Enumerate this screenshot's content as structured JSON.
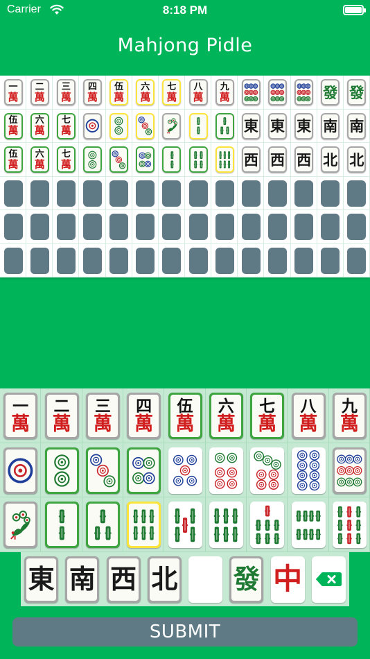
{
  "status_bar": {
    "carrier": "Carrier",
    "time": "8:18 PM"
  },
  "title": "Mahjong Pidle",
  "board": {
    "rows": [
      [
        {
          "suit": "man",
          "num": 1,
          "top": "一",
          "state": "gray"
        },
        {
          "suit": "man",
          "num": 2,
          "top": "二",
          "state": "gray"
        },
        {
          "suit": "man",
          "num": 3,
          "top": "三",
          "state": "gray"
        },
        {
          "suit": "man",
          "num": 4,
          "top": "四",
          "state": "gray"
        },
        {
          "suit": "man",
          "num": 5,
          "top": "伍",
          "state": "yellow"
        },
        {
          "suit": "man",
          "num": 6,
          "top": "六",
          "state": "yellow"
        },
        {
          "suit": "man",
          "num": 7,
          "top": "七",
          "state": "yellow"
        },
        {
          "suit": "man",
          "num": 8,
          "top": "八",
          "state": "gray"
        },
        {
          "suit": "man",
          "num": 9,
          "top": "九",
          "state": "gray"
        },
        {
          "suit": "pin",
          "num": 9,
          "state": "gray"
        },
        {
          "suit": "pin",
          "num": 9,
          "state": "gray"
        },
        {
          "suit": "pin",
          "num": 9,
          "state": "gray"
        },
        {
          "suit": "honor",
          "char": "發",
          "color": "green",
          "state": "gray"
        },
        {
          "suit": "honor",
          "char": "發",
          "color": "green",
          "state": "gray"
        }
      ],
      [
        {
          "suit": "man",
          "num": 5,
          "top": "伍",
          "state": "green"
        },
        {
          "suit": "man",
          "num": 6,
          "top": "六",
          "state": "green"
        },
        {
          "suit": "man",
          "num": 7,
          "top": "七",
          "state": "green"
        },
        {
          "suit": "pin",
          "num": 1,
          "state": "gray"
        },
        {
          "suit": "pin",
          "num": 2,
          "state": "yellow"
        },
        {
          "suit": "pin",
          "num": 3,
          "state": "yellow"
        },
        {
          "suit": "sou",
          "num": 1,
          "state": "gray"
        },
        {
          "suit": "sou",
          "num": 2,
          "state": "yellow"
        },
        {
          "suit": "sou",
          "num": 3,
          "state": "green"
        },
        {
          "suit": "honor",
          "char": "東",
          "color": "black",
          "state": "gray"
        },
        {
          "suit": "honor",
          "char": "東",
          "color": "black",
          "state": "gray"
        },
        {
          "suit": "honor",
          "char": "東",
          "color": "black",
          "state": "gray"
        },
        {
          "suit": "honor",
          "char": "南",
          "color": "black",
          "state": "gray"
        },
        {
          "suit": "honor",
          "char": "南",
          "color": "black",
          "state": "gray"
        }
      ],
      [
        {
          "suit": "man",
          "num": 5,
          "top": "伍",
          "state": "green"
        },
        {
          "suit": "man",
          "num": 6,
          "top": "六",
          "state": "green"
        },
        {
          "suit": "man",
          "num": 7,
          "top": "七",
          "state": "green"
        },
        {
          "suit": "pin",
          "num": 2,
          "state": "green"
        },
        {
          "suit": "pin",
          "num": 3,
          "state": "green"
        },
        {
          "suit": "pin",
          "num": 4,
          "state": "green"
        },
        {
          "suit": "sou",
          "num": 2,
          "state": "green"
        },
        {
          "suit": "sou",
          "num": 4,
          "state": "green"
        },
        {
          "suit": "sou",
          "num": 6,
          "state": "yellow"
        },
        {
          "suit": "honor",
          "char": "西",
          "color": "black",
          "state": "gray"
        },
        {
          "suit": "honor",
          "char": "西",
          "color": "black",
          "state": "gray"
        },
        {
          "suit": "honor",
          "char": "西",
          "color": "black",
          "state": "gray"
        },
        {
          "suit": "honor",
          "char": "北",
          "color": "black",
          "state": "gray"
        },
        {
          "suit": "honor",
          "char": "北",
          "color": "black",
          "state": "gray"
        }
      ],
      [],
      [],
      []
    ]
  },
  "keyboard": {
    "rows": [
      [
        {
          "suit": "man",
          "num": 1,
          "top": "一",
          "state": "gray"
        },
        {
          "suit": "man",
          "num": 2,
          "top": "二",
          "state": "gray"
        },
        {
          "suit": "man",
          "num": 3,
          "top": "三",
          "state": "gray"
        },
        {
          "suit": "man",
          "num": 4,
          "top": "四",
          "state": "gray"
        },
        {
          "suit": "man",
          "num": 5,
          "top": "伍",
          "state": "green"
        },
        {
          "suit": "man",
          "num": 6,
          "top": "六",
          "state": "green"
        },
        {
          "suit": "man",
          "num": 7,
          "top": "七",
          "state": "green"
        },
        {
          "suit": "man",
          "num": 8,
          "top": "八",
          "state": "gray"
        },
        {
          "suit": "man",
          "num": 9,
          "top": "九",
          "state": "gray"
        }
      ],
      [
        {
          "suit": "pin",
          "num": 1,
          "state": "gray"
        },
        {
          "suit": "pin",
          "num": 2,
          "state": "green"
        },
        {
          "suit": "pin",
          "num": 3,
          "state": "green"
        },
        {
          "suit": "pin",
          "num": 4,
          "state": "green"
        },
        {
          "suit": "pin",
          "num": 5,
          "state": "white"
        },
        {
          "suit": "pin",
          "num": 6,
          "state": "white"
        },
        {
          "suit": "pin",
          "num": 7,
          "state": "white"
        },
        {
          "suit": "pin",
          "num": 8,
          "state": "white"
        },
        {
          "suit": "pin",
          "num": 9,
          "state": "gray"
        }
      ],
      [
        {
          "suit": "sou",
          "num": 1,
          "state": "gray"
        },
        {
          "suit": "sou",
          "num": 2,
          "state": "green"
        },
        {
          "suit": "sou",
          "num": 3,
          "state": "green"
        },
        {
          "suit": "sou",
          "num": 6,
          "state": "yellow"
        },
        {
          "suit": "sou",
          "num": 5,
          "state": "white"
        },
        {
          "suit": "sou",
          "num": 6,
          "state": "white"
        },
        {
          "suit": "sou",
          "num": 7,
          "state": "white"
        },
        {
          "suit": "sou",
          "num": 8,
          "state": "white"
        },
        {
          "suit": "sou",
          "num": 9,
          "state": "white"
        }
      ]
    ],
    "honors": [
      {
        "char": "東",
        "color": "black",
        "state": "gray"
      },
      {
        "char": "南",
        "color": "black",
        "state": "gray"
      },
      {
        "char": "西",
        "color": "black",
        "state": "gray"
      },
      {
        "char": "北",
        "color": "black",
        "state": "gray"
      },
      {
        "char": "",
        "color": "none",
        "state": "blank"
      },
      {
        "char": "發",
        "color": "green",
        "state": "gray"
      },
      {
        "char": "中",
        "color": "red",
        "state": "white"
      },
      {
        "char": "",
        "color": "none",
        "state": "backspace"
      }
    ]
  },
  "submit_label": "SUBMIT",
  "colors": {
    "background": "#00b45a",
    "tile_gray": "#a6a6a6",
    "tile_green": "#3ea541",
    "tile_yellow": "#fbe53c",
    "tile_empty": "#607a85",
    "keyboard_bg": "#c6e9d4",
    "submit_bg": "#607a85"
  },
  "icons": [
    "wifi-icon",
    "battery-icon",
    "backspace-icon"
  ]
}
